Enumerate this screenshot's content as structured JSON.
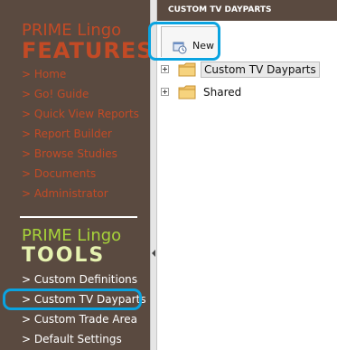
{
  "sidebar": {
    "features_title_top": "PRIME Lingo",
    "features_title_bottom": "FEATURES",
    "feature_links": [
      "> Home",
      "> Go! Guide",
      "> Quick View Reports",
      "> Report Builder",
      "> Browse Studies",
      "> Documents",
      "> Administrator"
    ],
    "tools_title_top": "PRIME Lingo",
    "tools_title_bottom": "TOOLS",
    "tool_links": [
      "> Custom Definitions",
      "> Custom TV Dayparts",
      "> Custom Trade Area",
      "> Default Settings"
    ]
  },
  "panel": {
    "title": "CUSTOM TV DAYPARTS",
    "new_button_label": "New",
    "tree": [
      {
        "label": "Custom TV Dayparts",
        "selected": true
      },
      {
        "label": "Shared",
        "selected": false
      }
    ]
  },
  "colors": {
    "sidebar_bg": "#5a4a40",
    "features_text": "#c34a25",
    "tools_accent": "#a7d33a",
    "highlight": "#0aa3e0",
    "folder": "#f2c46b"
  },
  "icons": [
    "new-document-icon",
    "folder-icon",
    "expand-plus-icon",
    "splitter-arrow-icon"
  ]
}
